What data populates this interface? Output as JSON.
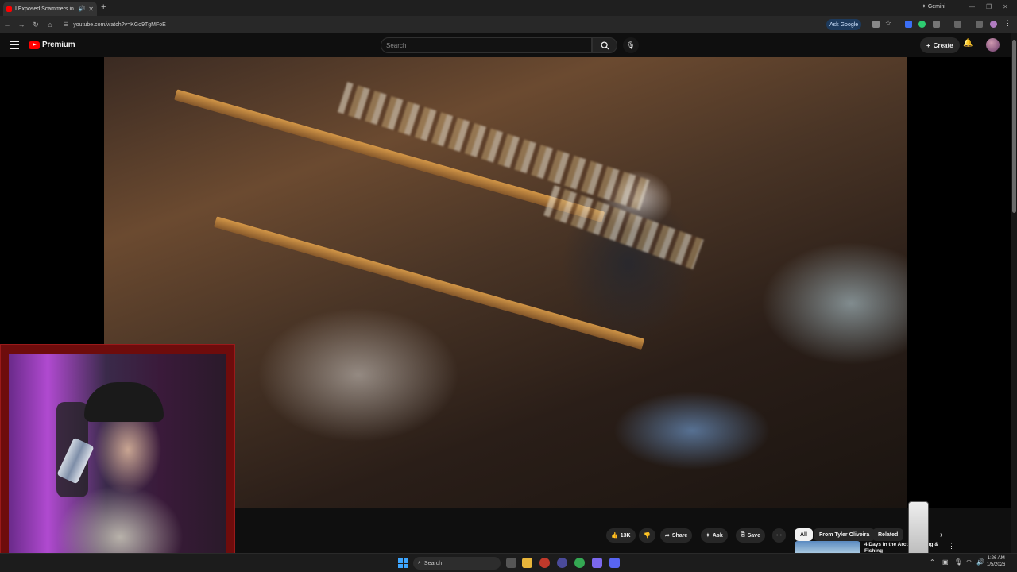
{
  "browser": {
    "tab_title": "I Exposed Scammers in Tok",
    "new_tab": "+",
    "gemini_label": "Gemini",
    "url": "youtube.com/watch?v=KGo9TgMFoE",
    "ask_google": "Ask Google"
  },
  "youtube": {
    "logo_text": "Premium",
    "search_placeholder": "Search",
    "create_label": "Create",
    "accent_color": "#ff0000"
  },
  "actions": {
    "like_count": "13K",
    "share_label": "Share",
    "ask_label": "Ask",
    "save_label": "Save"
  },
  "chips": [
    "All",
    "From Tyler Oliveira",
    "Related"
  ],
  "recommendation": {
    "title": "4 Days in the Arctic Hunting & Fishing"
  },
  "taskbar": {
    "search_label": "Search",
    "time": "1:26 AM",
    "date": "1/5/2026"
  }
}
